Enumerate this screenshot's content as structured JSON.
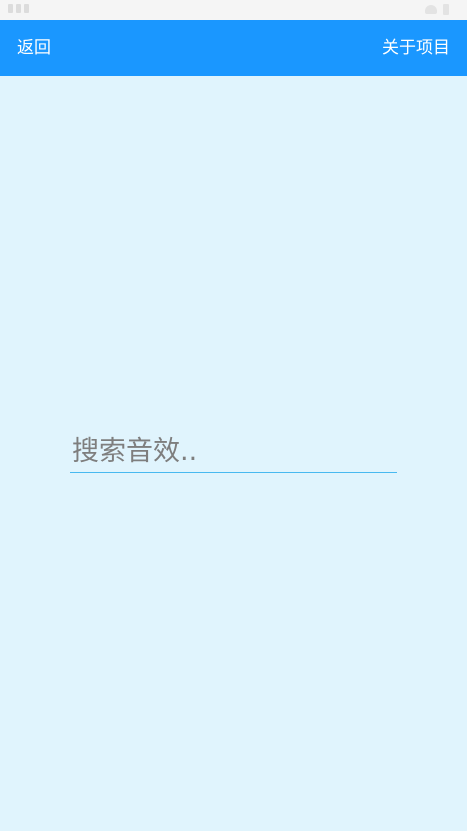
{
  "header": {
    "back_label": "返回",
    "about_label": "关于项目"
  },
  "search": {
    "placeholder": "搜索音效..",
    "value": ""
  },
  "colors": {
    "app_bar": "#1a97ff",
    "background": "#e0f4fd",
    "input_underline": "#48b9f0"
  }
}
